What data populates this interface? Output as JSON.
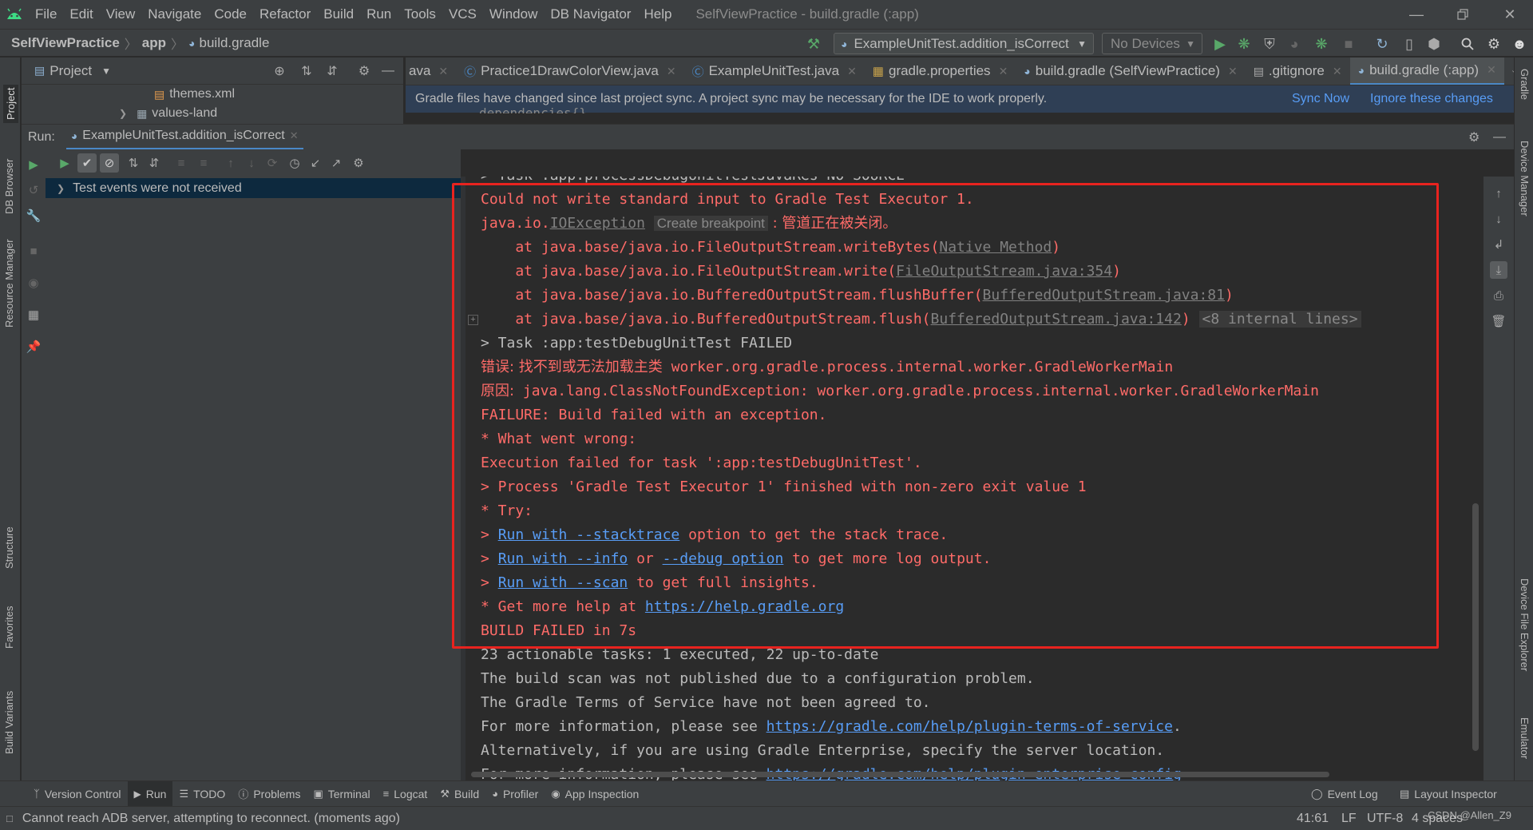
{
  "menubar": {
    "items": [
      "File",
      "Edit",
      "View",
      "Navigate",
      "Code",
      "Refactor",
      "Build",
      "Run",
      "Tools",
      "VCS",
      "Window",
      "DB Navigator",
      "Help"
    ],
    "window_title": "SelfViewPractice - build.gradle (:app)"
  },
  "navbar": {
    "breadcrumb": [
      "SelfViewPractice",
      "app",
      "build.gradle"
    ],
    "run_config": "ExampleUnitTest.addition_isCorrect",
    "device": "No Devices"
  },
  "left_strip": {
    "tabs": [
      "Project",
      "DB Browser",
      "Resource Manager",
      "Structure",
      "Favorites",
      "Build Variants"
    ]
  },
  "right_strip": {
    "tabs": [
      "Gradle",
      "Device Manager",
      "Device File Explorer",
      "Emulator"
    ]
  },
  "project_panel": {
    "title": "Project",
    "tree": [
      {
        "label": "themes.xml",
        "icon": "xml-file-icon"
      },
      {
        "label": "values-land",
        "icon": "folder-icon"
      }
    ]
  },
  "editor_tabs": [
    {
      "label": "ava",
      "icon": "java-file-icon",
      "active": false
    },
    {
      "label": "Practice1DrawColorView.java",
      "icon": "java-class-icon",
      "active": false
    },
    {
      "label": "ExampleUnitTest.java",
      "icon": "java-class-icon",
      "active": false
    },
    {
      "label": "gradle.properties",
      "icon": "properties-file-icon",
      "active": false
    },
    {
      "label": "build.gradle (SelfViewPractice)",
      "icon": "gradle-icon",
      "active": false
    },
    {
      "label": ".gitignore",
      "icon": "gitignore-file-icon",
      "active": false
    },
    {
      "label": "build.gradle (:app)",
      "icon": "gradle-icon",
      "active": true
    }
  ],
  "sync_bar": {
    "message": "Gradle files have changed since last project sync. A project sync may be necessary for the IDE to work properly.",
    "sync_now": "Sync Now",
    "ignore": "Ignore these changes",
    "peek": "dependencies{}"
  },
  "run_panel": {
    "label": "Run:",
    "tab": "ExampleUnitTest.addition_isCorrect",
    "test_status": "Test events were not received"
  },
  "console": {
    "clipped_top": "> Task :app:processDebugUnitTestJavaRes NO-SOURCE",
    "l1": "Could not write standard input to Gradle Test Executor 1.",
    "l2_pre": "java.io.",
    "l2_link": "IOException",
    "l2_hint": "Create breakpoint",
    "l2_post": " : 管道正在被关闭。",
    "l3_pre": "    at java.base/java.io.FileOutputStream.writeBytes(",
    "l3_link": "Native Method",
    "l3_post": ")",
    "l4_pre": "    at java.base/java.io.FileOutputStream.write(",
    "l4_link": "FileOutputStream.java:354",
    "l4_post": ")",
    "l5_pre": "    at java.base/java.io.BufferedOutputStream.flushBuffer(",
    "l5_link": "BufferedOutputStream.java:81",
    "l5_post": ")",
    "l6_pre": "    at java.base/java.io.BufferedOutputStream.flush(",
    "l6_link": "BufferedOutputStream.java:142",
    "l6_post": ")",
    "l6_internal": "<8 internal lines>",
    "l7": "> Task :app:testDebugUnitTest FAILED",
    "l8_cjk": "错误: 找不到或无法加载主类",
    "l8_rest": " worker.org.gradle.process.internal.worker.GradleWorkerMain",
    "l9_cjk": "原因:",
    "l9_rest": " java.lang.ClassNotFoundException: worker.org.gradle.process.internal.worker.GradleWorkerMain",
    "l10": "FAILURE: Build failed with an exception.",
    "l11": "* What went wrong:",
    "l12": "Execution failed for task ':app:testDebugUnitTest'.",
    "l13": "> Process 'Gradle Test Executor 1' finished with non-zero exit value 1",
    "l14": "* Try:",
    "l15_pre": "> ",
    "l15_link": "Run with --stacktrace",
    "l15_post": " option to get the stack trace.",
    "l16_pre": "> ",
    "l16_link1": "Run with --info",
    "l16_mid": " or ",
    "l16_link2": "--debug option",
    "l16_post": " to get more log output.",
    "l17_pre": "> ",
    "l17_link": "Run with --scan",
    "l17_post": " to get full insights.",
    "l18_pre": "* Get more help at ",
    "l18_link": "https://help.gradle.org",
    "l19": "BUILD FAILED in 7s",
    "l20": "23 actionable tasks: 1 executed, 22 up-to-date",
    "l21": "The build scan was not published due to a configuration problem.",
    "l22": "The Gradle Terms of Service have not been agreed to.",
    "l23_pre": "For more information, please see ",
    "l23_link": "https://gradle.com/help/plugin-terms-of-service",
    "l23_post": ".",
    "l24": "Alternatively, if you are using Gradle Enterprise, specify the server location.",
    "l25_pre": "For more information, please see ",
    "l25_link": "https://gradle.com/help/plugin-enterprise-config"
  },
  "bottom_tabs": {
    "left": [
      "Version Control",
      "Run",
      "TODO",
      "Problems",
      "Terminal",
      "Logcat",
      "Build",
      "Profiler",
      "App Inspection"
    ],
    "right": [
      "Event Log",
      "Layout Inspector"
    ]
  },
  "statusbar": {
    "message": "Cannot reach ADB server, attempting to reconnect. (moments ago)",
    "position": "41:61",
    "line_sep": "LF",
    "encoding": "UTF-8",
    "indent": "4 spaces",
    "watermark": "CSDN @Allen_Z9"
  },
  "colors": {
    "accent": "#4a88c7",
    "error": "#ff6b68",
    "link": "#589df6",
    "run_green": "#59a869",
    "highlight_box": "#e8231f"
  }
}
